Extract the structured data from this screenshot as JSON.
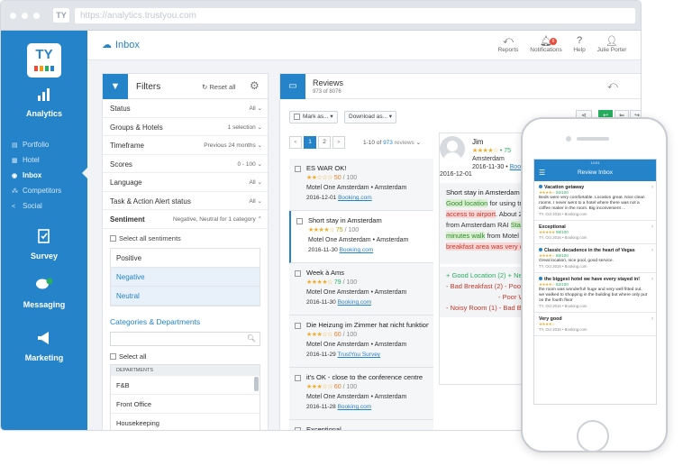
{
  "browser": {
    "logo_text": "TY",
    "url": "https://analytics.trustyou.com"
  },
  "sidebar": {
    "logo_text": "TY",
    "analytics_label": "Analytics",
    "sub_items": [
      {
        "label": "Portfolio"
      },
      {
        "label": "Hotel"
      },
      {
        "label": "Inbox"
      },
      {
        "label": "Competitors"
      },
      {
        "label": "Social"
      }
    ],
    "survey_label": "Survey",
    "messaging_label": "Messaging",
    "marketing_label": "Marketing"
  },
  "topbar": {
    "title": "Inbox",
    "actions": [
      {
        "label": "Reports"
      },
      {
        "label": "Notifications",
        "badge": "6"
      },
      {
        "label": "Help"
      },
      {
        "label": "Julie Porter"
      }
    ]
  },
  "filters": {
    "title": "Filters",
    "reset_label": "Reset all",
    "rows": [
      {
        "label": "Status",
        "value": "All"
      },
      {
        "label": "Groups & Hotels",
        "value": "1 selection"
      },
      {
        "label": "Timeframe",
        "value": "Previous 24 months"
      },
      {
        "label": "Scores",
        "value": "0 - 100"
      },
      {
        "label": "Language",
        "value": "All"
      },
      {
        "label": "Task & Action Alert status",
        "value": "All"
      }
    ],
    "sentiment": {
      "label": "Sentiment",
      "value": "Negative, Neutral for 1 category",
      "select_all": "Select all sentiments",
      "options": [
        "Positive",
        "Negative",
        "Neutral"
      ]
    },
    "categories": {
      "title": "Categories & Departments",
      "select_all": "Select all",
      "header": "DEPARTMENTS",
      "items": [
        "F&B",
        "Front Office",
        "Housekeeping"
      ]
    }
  },
  "reviews": {
    "title": "Reviews",
    "count": "973 of 8076",
    "mark_as": "Mark as...",
    "download_as": "Download as...",
    "pages": [
      "1",
      "2"
    ],
    "range": "1-10",
    "of_word": "of",
    "total": "973",
    "reviews_word": "reviews",
    "items": [
      {
        "title": "ES WAR OK!",
        "stars": "★★☆☆☆",
        "score": "50",
        "out_of": "/ 100",
        "hotel": "Motel One Amsterdam • Amsterdam",
        "date": "2016-12-01",
        "source": "Booking.com",
        "cls": ""
      },
      {
        "title": "Short stay in Amsterdam",
        "stars": "★★★★☆",
        "score": "75",
        "out_of": "/ 100",
        "hotel": "Motel One Amsterdam • Amsterdam",
        "date": "2016-11-30",
        "source": "Booking.com",
        "cls": "y"
      },
      {
        "title": "Week à Ams",
        "stars": "★★★★☆",
        "score": "79",
        "out_of": "/ 100",
        "hotel": "Motel One Amsterdam • Amsterdam",
        "date": "2016-11-30",
        "source": "Booking.com",
        "cls": "g"
      },
      {
        "title": "Die Heizung im Zimmer hat nicht funktioniert",
        "stars": "★★★☆☆",
        "score": "60",
        "out_of": "/ 100",
        "hotel": "Motel One Amsterdam • Amsterdam",
        "date": "2016-11-29",
        "source": "TrustYou Survey",
        "cls": ""
      },
      {
        "title": "it's OK - close to the conference centre",
        "stars": "★★★☆☆",
        "score": "60",
        "out_of": "/ 100",
        "hotel": "Motel One Amsterdam • Amsterdam",
        "date": "2016-11-28",
        "source": "Booking.com",
        "cls": ""
      },
      {
        "title": "Exceptional",
        "stars": "★★★★★",
        "score": "",
        "out_of": "",
        "hotel": "",
        "date": "",
        "source": "",
        "cls": ""
      }
    ],
    "detail": {
      "name": "Jim",
      "stars": "★★★★☆",
      "score": "75",
      "location": "Amsterdam",
      "date": "2016-11-30",
      "source": "Booking.com",
      "date2": "2016-12-01",
      "title": "Short stay in Amsterdam",
      "text_1": "Good location",
      "text_2": "for using tr",
      "text_3": "access to airport",
      "text_4": ". About 2",
      "text_5": "from Amsterdam RAI",
      "text_6": "Stat",
      "text_7": "minutes walk",
      "text_8": "from Motel",
      "text_9": "breakfast area was very c",
      "tags": [
        {
          "bullet": "+",
          "label": "Good Location (2)",
          "cls": "g"
        },
        {
          "bullet": "-",
          "label": "Bad Breakfast (2)",
          "cls": "r"
        },
        {
          "bullet": "-",
          "label": "Noisy Room (1)",
          "cls": "r"
        }
      ],
      "tags_right": [
        {
          "bullet": "+",
          "label": "Near",
          "cls": "g"
        },
        {
          "bullet": "-",
          "label": "Poor H",
          "cls": "r"
        },
        {
          "bullet": "-",
          "label": "Bad Bre",
          "cls": "r"
        },
        {
          "bullet": "-",
          "label": "Poor W",
          "cls": "r"
        }
      ]
    }
  },
  "phone": {
    "status": "12:01",
    "title": "Review Inbox",
    "items": [
      {
        "title": "Vacation getaway",
        "stars": "★★★★☆",
        "score": "92/100",
        "text": "Beds were very comfortable. Location great. Nice clean rooms. I never went to a hotel where there was not a coffee maker in the room. Big inconvenient ...",
        "meta": "TY, Oct 2016 • Booking.com",
        "dot": true
      },
      {
        "title": "Exceptional",
        "stars": "★★★★★",
        "score": "98/100",
        "text": "",
        "meta": "TY, Oct 2016 • Booking.com",
        "dot": false
      },
      {
        "title": "Classic decadence in the heart of Vegas",
        "stars": "★★★★☆",
        "score": "88/100",
        "text": "Great location, nice pool, good service.",
        "meta": "TY, Oct 2016 • Booking.com",
        "dot": true
      },
      {
        "title": "the biggest hotel we have every stayed in!",
        "stars": "★★★★☆",
        "score": "82/100",
        "text": "the room was wonderful! huge and very well fitted out. we walked to shopping in the building but where only put on the fourth floor",
        "meta": "TY, Oct 2016 • Booking.com",
        "dot": true
      },
      {
        "title": "Very good",
        "stars": "★★★★☆",
        "score": "",
        "text": "",
        "meta": "TY, Oct 2016 • Booking.com",
        "dot": false
      }
    ]
  },
  "colors": {
    "brand": "#2583c9",
    "star": "#f0ad2b"
  }
}
